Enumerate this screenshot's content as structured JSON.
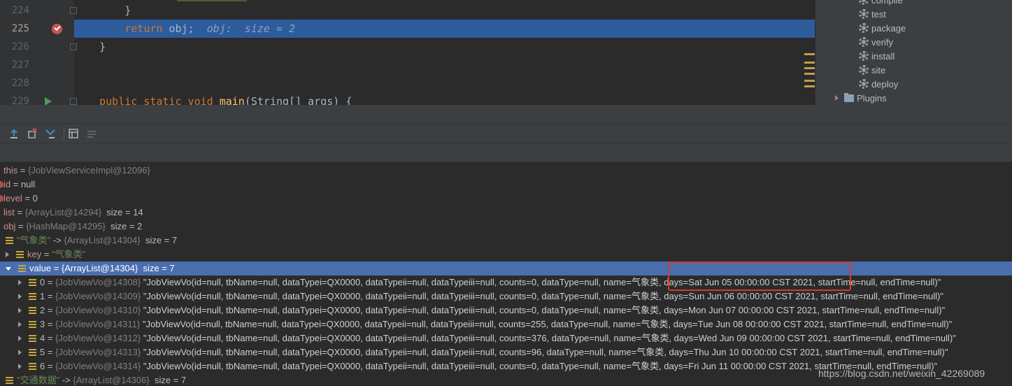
{
  "editor": {
    "lines": [
      {
        "num": "224",
        "code_plain": "        }"
      },
      {
        "num": "225",
        "kw": "return",
        "var": " obj;",
        "hint": "  obj:  size = 2"
      },
      {
        "num": "226",
        "code_plain": "    }"
      },
      {
        "num": "227",
        "code_plain": ""
      },
      {
        "num": "228",
        "code_plain": ""
      },
      {
        "num": "229",
        "kw": "public static void ",
        "fn": "main",
        "rest": "(String[] args) {"
      }
    ]
  },
  "maven": {
    "items": [
      "compile",
      "test",
      "package",
      "verify",
      "install",
      "site",
      "deploy"
    ],
    "plugins_label": "Plugins"
  },
  "variables": [
    {
      "name": "this",
      "eq": " = ",
      "ref": "{JobViewServiceImpl@12096}"
    },
    {
      "name": "id",
      "eq": " = ",
      "val": "null"
    },
    {
      "name": "level",
      "eq": " = ",
      "val": "0"
    },
    {
      "name": "list",
      "eq": " = ",
      "ref": "{ArrayList@14294}",
      "extra": "  size = 14"
    },
    {
      "name": "obj",
      "eq": " = ",
      "ref": "{HashMap@14295}",
      "extra": "  size = 2"
    },
    {
      "key": "\"气象类\"",
      "arrow": " -> ",
      "ref": "{ArrayList@14304}",
      "extra": "  size = 7"
    },
    {
      "name": "key",
      "eq": " = ",
      "str": "\"气象类\""
    },
    {
      "name": "value",
      "eq": " = ",
      "ref": "{ArrayList@14304}",
      "extra": "  size = 7"
    },
    {
      "idx": "0",
      "ref": "{JobViewVo@14308}",
      "str": "\"JobViewVo(id=null, tbName=null, dataTypei=QX0000, dataTypeii=null, dataTypeiii=null, counts=0, dataType=null, name=气象类, days=Sat Jun 05 00:00:00 CST 2021, startTime=null, endTime=null)\""
    },
    {
      "idx": "1",
      "ref": "{JobViewVo@14309}",
      "str": "\"JobViewVo(id=null, tbName=null, dataTypei=QX0000, dataTypeii=null, dataTypeiii=null, counts=0, dataType=null, name=气象类, days=Sun Jun 06 00:00:00 CST 2021, startTime=null, endTime=null)\""
    },
    {
      "idx": "2",
      "ref": "{JobViewVo@14310}",
      "str": "\"JobViewVo(id=null, tbName=null, dataTypei=QX0000, dataTypeii=null, dataTypeiii=null, counts=0, dataType=null, name=气象类, days=Mon Jun 07 00:00:00 CST 2021, startTime=null, endTime=null)\""
    },
    {
      "idx": "3",
      "ref": "{JobViewVo@14311}",
      "str": "\"JobViewVo(id=null, tbName=null, dataTypei=QX0000, dataTypeii=null, dataTypeiii=null, counts=255, dataType=null, name=气象类, days=Tue Jun 08 00:00:00 CST 2021, startTime=null, endTime=null)\""
    },
    {
      "idx": "4",
      "ref": "{JobViewVo@14312}",
      "str": "\"JobViewVo(id=null, tbName=null, dataTypei=QX0000, dataTypeii=null, dataTypeiii=null, counts=376, dataType=null, name=气象类, days=Wed Jun 09 00:00:00 CST 2021, startTime=null, endTime=null)\""
    },
    {
      "idx": "5",
      "ref": "{JobViewVo@14313}",
      "str": "\"JobViewVo(id=null, tbName=null, dataTypei=QX0000, dataTypeii=null, dataTypeiii=null, counts=96, dataType=null, name=气象类, days=Thu Jun 10 00:00:00 CST 2021, startTime=null, endTime=null)\""
    },
    {
      "idx": "6",
      "ref": "{JobViewVo@14314}",
      "str": "\"JobViewVo(id=null, tbName=null, dataTypei=QX0000, dataTypeii=null, dataTypeiii=null, counts=0, dataType=null, name=气象类, days=Fri Jun 11 00:00:00 CST 2021, startTime=null, endTime=null)\""
    },
    {
      "key": "\"交通数据\"",
      "arrow": " -> ",
      "ref": "{ArrayList@14306}",
      "extra": "  size = 7"
    }
  ],
  "watermark": "https://blog.csdn.net/weixin_42269089",
  "colors": {
    "selection": "#4b6eaf",
    "current_line": "#2d5c9d",
    "highlight_box": "#d63a2c"
  }
}
